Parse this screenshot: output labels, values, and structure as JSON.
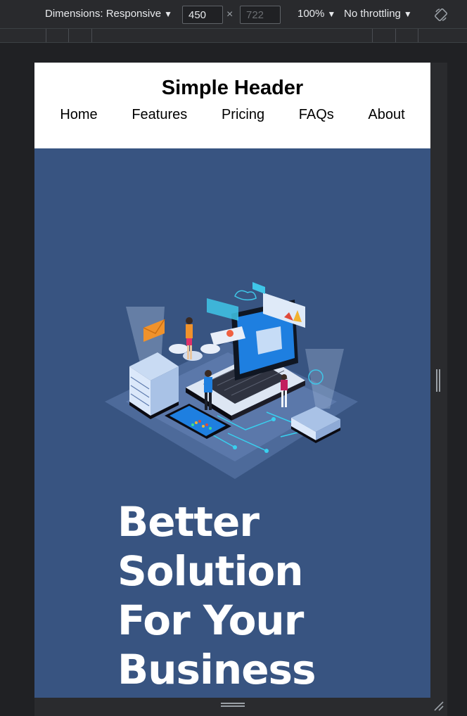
{
  "devtools": {
    "dimensions_label": "Dimensions: Responsive",
    "width_value": "450",
    "height_placeholder": "722",
    "times_symbol": "×",
    "zoom_label": "100%",
    "throttling_label": "No throttling",
    "caret": "▼"
  },
  "page": {
    "header_title": "Simple Header",
    "nav": [
      "Home",
      "Features",
      "Pricing",
      "FAQs",
      "About"
    ],
    "hero_lines": [
      "Better",
      "Solution",
      "For Your",
      "Business"
    ]
  },
  "colors": {
    "hero_background": "#385481",
    "devtools_background": "#202124"
  },
  "icons": {
    "rotate": "rotate-icon",
    "illustration": "isometric-tech-illustration"
  }
}
